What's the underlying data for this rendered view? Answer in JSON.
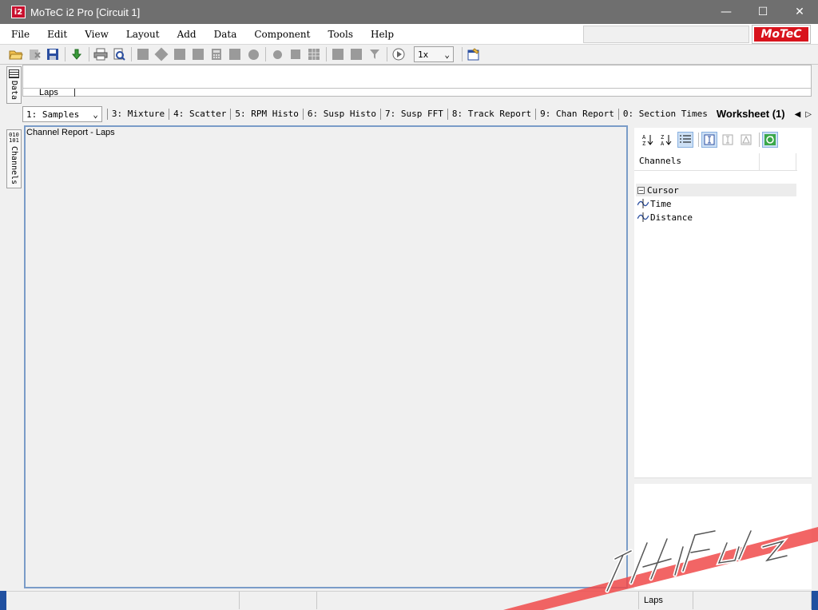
{
  "window": {
    "app_icon_text": "i2",
    "title": "MoTeC i2 Pro [Circuit 1]",
    "controls": {
      "minimize": "—",
      "maximize": "☐",
      "close": "✕"
    }
  },
  "menu": {
    "items": [
      "File",
      "Edit",
      "View",
      "Layout",
      "Add",
      "Data",
      "Component",
      "Tools",
      "Help"
    ],
    "logo": "MoTeC"
  },
  "toolbar": {
    "speed": "1x"
  },
  "sidebar": {
    "data_tab": "Data",
    "channels_tab": "Channels"
  },
  "laps": {
    "label": "Laps"
  },
  "worksheets": {
    "selected": "1: Samples",
    "tabs": [
      "3: Mixture",
      "4: Scatter",
      "5: RPM Histo",
      "6: Susp Histo",
      "7: Susp FFT",
      "8: Track Report",
      "9: Chan Report",
      "0: Section Times"
    ],
    "active": "Worksheet (1)"
  },
  "main": {
    "title": "Channel Report - Laps"
  },
  "channel_panel": {
    "header": "Channels",
    "group": "Cursor",
    "items": [
      "Time",
      "Distance"
    ]
  },
  "status": {
    "laps": "Laps"
  },
  "colors": {
    "titlebar": "#6f6f6f",
    "brand_red": "#d8131c",
    "panel_border": "#7a9cc8"
  }
}
